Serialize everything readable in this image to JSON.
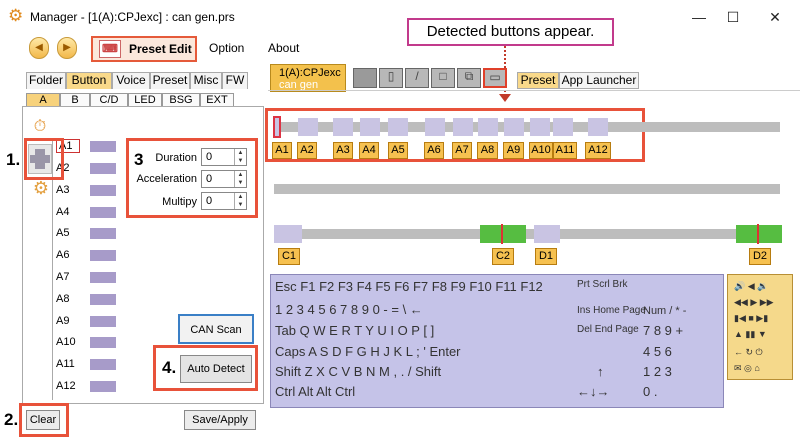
{
  "window": {
    "title": "Manager - [1(A):CPJexc] : can gen.prs",
    "minimize": "—",
    "maximize": "☐",
    "close": "✕"
  },
  "toolbar": {
    "back_icon": "◀",
    "forward_icon": "▶",
    "preset_edit": "Preset Edit",
    "menus": [
      "Option",
      "About"
    ]
  },
  "callout": "Detected buttons appear.",
  "tabs": [
    "Folder",
    "Button",
    "Voice",
    "Preset",
    "Misc",
    "FW"
  ],
  "subtabs": [
    "A",
    "B",
    "C/D",
    "LED",
    "BSG",
    "EXT"
  ],
  "preset_tab": {
    "line1": "1(A):CPJexc",
    "line2": "can gen"
  },
  "right_tabs": [
    "Preset",
    "App Launcher"
  ],
  "rows": [
    "A1",
    "A2",
    "A3",
    "A4",
    "A5",
    "A6",
    "A7",
    "A8",
    "A9",
    "A10",
    "A11",
    "A12"
  ],
  "fields": [
    {
      "label": "Duration",
      "value": "0"
    },
    {
      "label": "Acceleration",
      "value": "0"
    },
    {
      "label": "Multipy",
      "value": "0"
    }
  ],
  "buttons": {
    "can_scan": "CAN Scan",
    "auto_detect": "Auto Detect",
    "clear": "Clear",
    "save_apply": "Save/Apply"
  },
  "steps": [
    "1.",
    "2.",
    "3",
    "4."
  ],
  "track_labels": [
    "A1",
    "A2",
    "A3",
    "A4",
    "A5",
    "A6",
    "A7",
    "A8",
    "A9",
    "A10",
    "A11",
    "A12"
  ],
  "c_labels": [
    "C1",
    "C2",
    "D1",
    "D2"
  ],
  "keyboard": {
    "r1": "Esc    F1 F2 F3 F4   F5 F6 F7 F8   F9 F10 F11 F12",
    "r2": "   1  2  3  4  5  6  7  8  9  0  -  =  \\  ←",
    "r3": "Tab Q  W E  R  T  Y  U  I  O  P  [  ]",
    "r4": "Caps A  S  D  F  G  H  J  K  L  ;  '     Enter",
    "r5": "Shift  Z  X  C  V  B  N  M  ,  .  /     Shift",
    "r6": "Ctrl    Alt                                  Alt         Ctrl",
    "nav1": "Prt Scrl Brk",
    "nav2": "Ins Home Page",
    "nav3": "Del End Page",
    "num1": "Num /  *  -",
    "num2": "7  8  9  +",
    "num3": "4  5  6",
    "num4": "1  2  3",
    "num5": "0     ."
  }
}
